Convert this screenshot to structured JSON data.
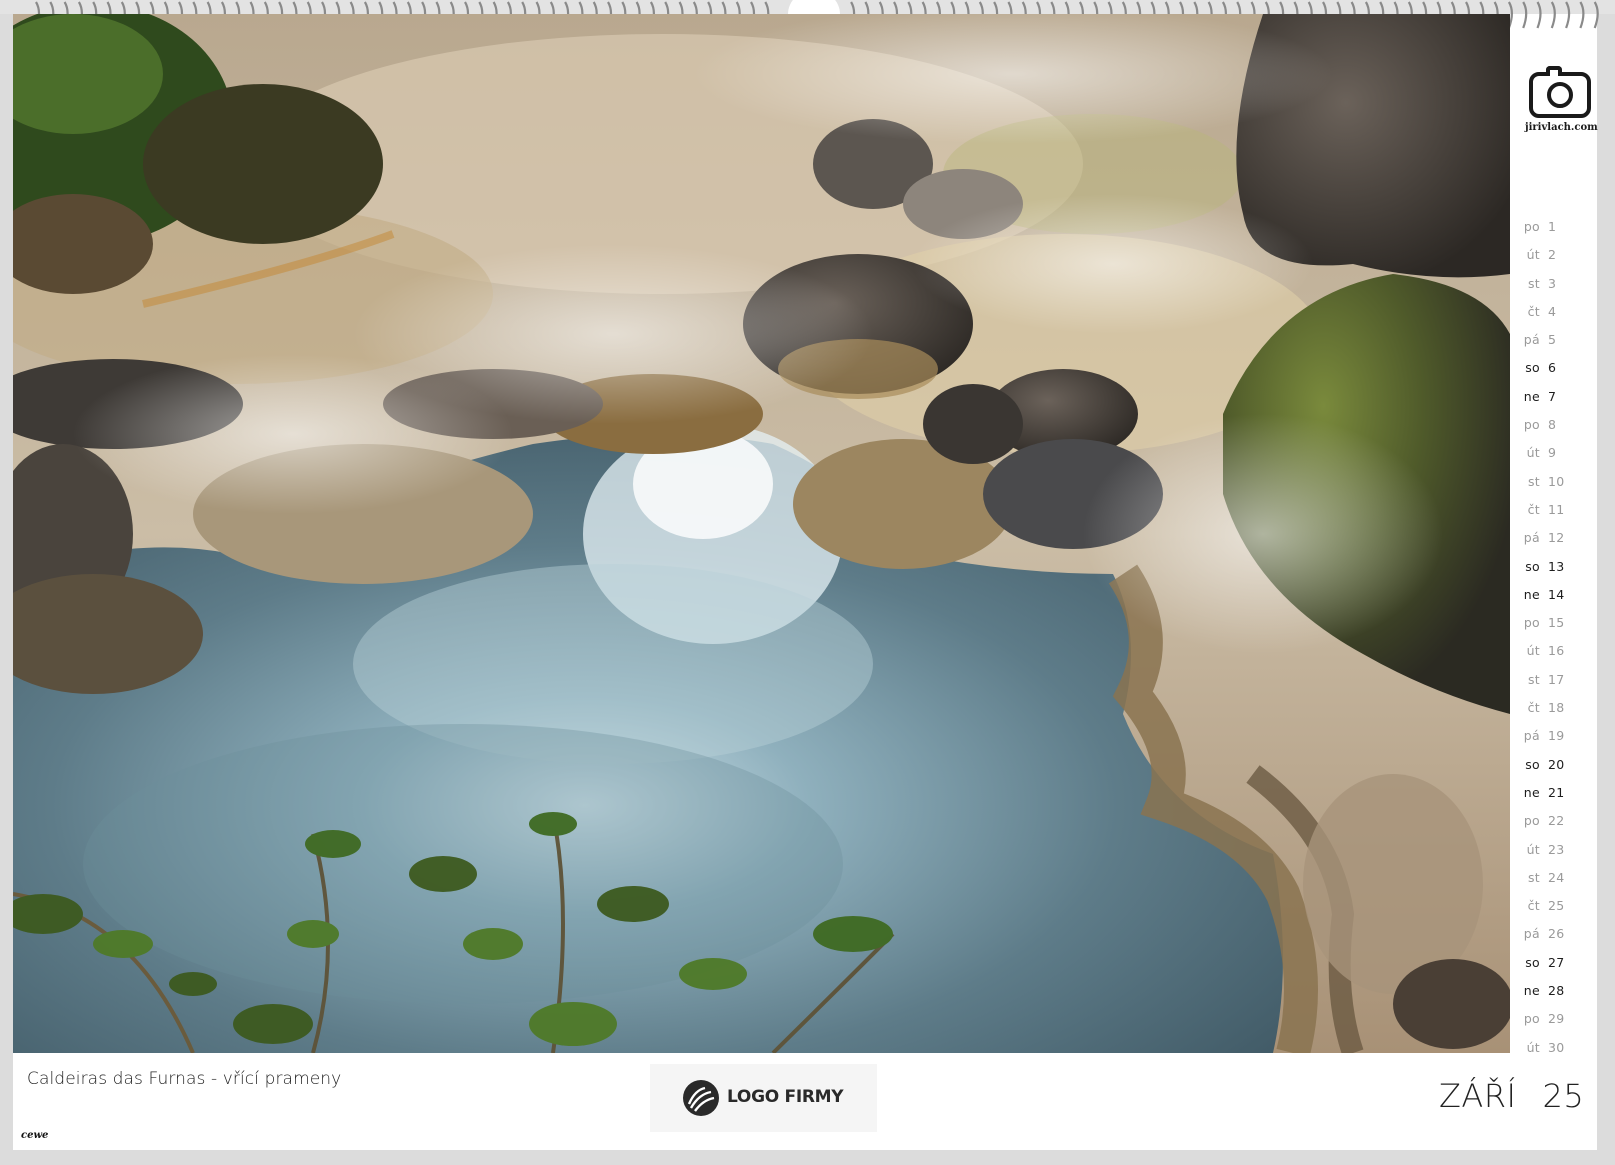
{
  "photo": {
    "alt": "Steaming hot spring pool with rocks and vegetation"
  },
  "right_column": {
    "logo_url": "jirivlach.com"
  },
  "days": [
    {
      "dw": "po",
      "n": "1",
      "weekend": false
    },
    {
      "dw": "út",
      "n": "2",
      "weekend": false
    },
    {
      "dw": "st",
      "n": "3",
      "weekend": false
    },
    {
      "dw": "čt",
      "n": "4",
      "weekend": false
    },
    {
      "dw": "pá",
      "n": "5",
      "weekend": false
    },
    {
      "dw": "so",
      "n": "6",
      "weekend": true
    },
    {
      "dw": "ne",
      "n": "7",
      "weekend": true
    },
    {
      "dw": "po",
      "n": "8",
      "weekend": false
    },
    {
      "dw": "út",
      "n": "9",
      "weekend": false
    },
    {
      "dw": "st",
      "n": "10",
      "weekend": false
    },
    {
      "dw": "čt",
      "n": "11",
      "weekend": false
    },
    {
      "dw": "pá",
      "n": "12",
      "weekend": false
    },
    {
      "dw": "so",
      "n": "13",
      "weekend": true
    },
    {
      "dw": "ne",
      "n": "14",
      "weekend": true
    },
    {
      "dw": "po",
      "n": "15",
      "weekend": false
    },
    {
      "dw": "út",
      "n": "16",
      "weekend": false
    },
    {
      "dw": "st",
      "n": "17",
      "weekend": false
    },
    {
      "dw": "čt",
      "n": "18",
      "weekend": false
    },
    {
      "dw": "pá",
      "n": "19",
      "weekend": false
    },
    {
      "dw": "so",
      "n": "20",
      "weekend": true
    },
    {
      "dw": "ne",
      "n": "21",
      "weekend": true
    },
    {
      "dw": "po",
      "n": "22",
      "weekend": false
    },
    {
      "dw": "út",
      "n": "23",
      "weekend": false
    },
    {
      "dw": "st",
      "n": "24",
      "weekend": false
    },
    {
      "dw": "čt",
      "n": "25",
      "weekend": false
    },
    {
      "dw": "pá",
      "n": "26",
      "weekend": false
    },
    {
      "dw": "so",
      "n": "27",
      "weekend": true
    },
    {
      "dw": "ne",
      "n": "28",
      "weekend": true
    },
    {
      "dw": "po",
      "n": "29",
      "weekend": false
    },
    {
      "dw": "út",
      "n": "30",
      "weekend": false
    }
  ],
  "footer": {
    "caption": "Caldeiras das Furnas - vřící prameny",
    "brand": "cewe",
    "company_logo_text": "LOGO FIRMY",
    "month": "ZÁŘÍ",
    "year": "25"
  },
  "colors": {
    "weekday": "#9a9a9a",
    "weekend": "#1e1e1e",
    "water": "#6f8a96"
  }
}
